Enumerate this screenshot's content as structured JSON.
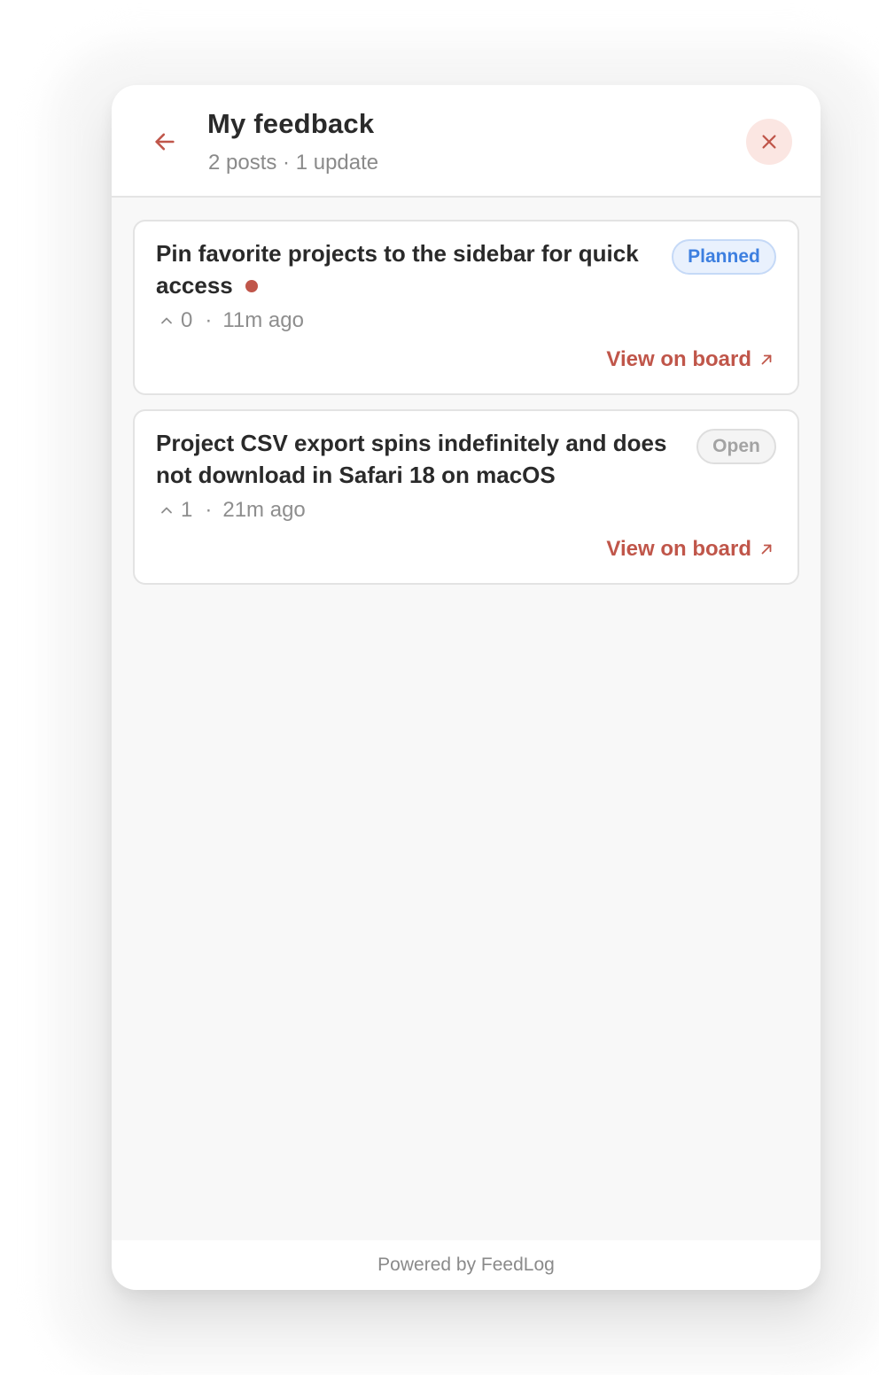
{
  "header": {
    "title": "My feedback",
    "subtitle": "2 posts · 1 update"
  },
  "posts": [
    {
      "title": "Pin favorite projects to the sidebar for quick access",
      "status": "Planned",
      "votes": "0",
      "time": "11m ago",
      "unread": true,
      "link_label": "View on board"
    },
    {
      "title": "Project CSV export spins indefinitely and does not download in Safari 18 on macOS",
      "status": "Open",
      "votes": "1",
      "time": "21m ago",
      "unread": false,
      "link_label": "View on board"
    }
  ],
  "meta_separator": "·",
  "footer": {
    "text": "Powered by FeedLog"
  },
  "colors": {
    "accent": "#c0564a",
    "planned": "#3d7fe0",
    "open": "#a3a3a3"
  },
  "icons": {
    "back": "arrow-left-icon",
    "close": "close-icon",
    "upvote": "chevron-up-icon",
    "external": "arrow-up-right-icon"
  }
}
